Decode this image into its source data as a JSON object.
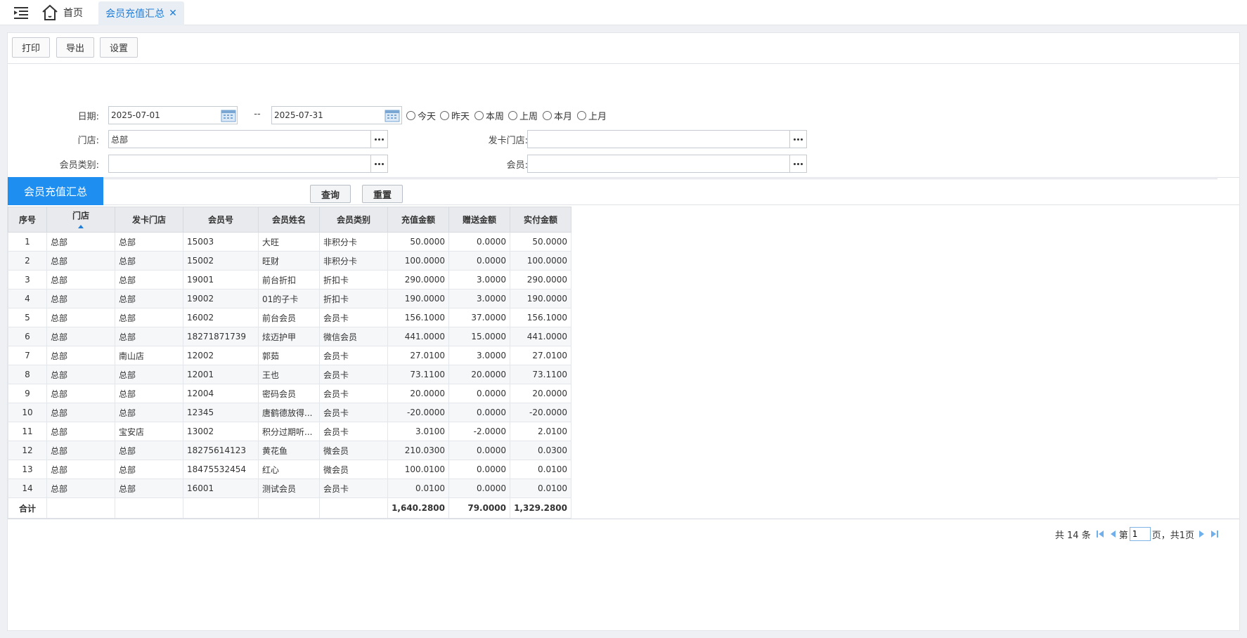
{
  "tabs": {
    "home_label": "首页",
    "active_label": "会员充值汇总",
    "close_glyph": "✕"
  },
  "toolbar": {
    "print_label": "打印",
    "export_label": "导出",
    "settings_label": "设置"
  },
  "filters": {
    "date_label": "日期:",
    "date_from": "2025-07-01",
    "date_sep": "--",
    "date_to": "2025-07-31",
    "quick_ranges": [
      "今天",
      "昨天",
      "本周",
      "上周",
      "本月",
      "上月"
    ],
    "store_label": "门店:",
    "store_value": "总部",
    "card_store_label": "发卡门店:",
    "card_store_value": "",
    "member_type_label": "会员类别:",
    "member_type_value": "",
    "member_label": "会员:",
    "member_value": "",
    "query_label": "查询",
    "reset_label": "重置"
  },
  "section": {
    "title": "会员充值汇总"
  },
  "table": {
    "columns": [
      "序号",
      "门店",
      "发卡门店",
      "会员号",
      "会员姓名",
      "会员类别",
      "充值金额",
      "赠送金额",
      "实付金额"
    ],
    "sorted_column": "门店",
    "rows": [
      [
        "1",
        "总部",
        "总部",
        "15003",
        "大旺",
        "非积分卡",
        "50.0000",
        "0.0000",
        "50.0000"
      ],
      [
        "2",
        "总部",
        "总部",
        "15002",
        "旺财",
        "非积分卡",
        "100.0000",
        "0.0000",
        "100.0000"
      ],
      [
        "3",
        "总部",
        "总部",
        "19001",
        "前台折扣",
        "折扣卡",
        "290.0000",
        "3.0000",
        "290.0000"
      ],
      [
        "4",
        "总部",
        "总部",
        "19002",
        "01的子卡",
        "折扣卡",
        "190.0000",
        "3.0000",
        "190.0000"
      ],
      [
        "5",
        "总部",
        "总部",
        "16002",
        "前台会员",
        "会员卡",
        "156.1000",
        "37.0000",
        "156.1000"
      ],
      [
        "6",
        "总部",
        "总部",
        "18271871739",
        "炫迈护甲",
        "微信会员",
        "441.0000",
        "15.0000",
        "441.0000"
      ],
      [
        "7",
        "总部",
        "南山店",
        "12002",
        "郭茹",
        "会员卡",
        "27.0100",
        "3.0000",
        "27.0100"
      ],
      [
        "8",
        "总部",
        "总部",
        "12001",
        "王也",
        "会员卡",
        "73.1100",
        "20.0000",
        "73.1100"
      ],
      [
        "9",
        "总部",
        "总部",
        "12004",
        "密码会员",
        "会员卡",
        "20.0000",
        "0.0000",
        "20.0000"
      ],
      [
        "10",
        "总部",
        "总部",
        "12345",
        "唐鹤德放得...",
        "会员卡",
        "-20.0000",
        "0.0000",
        "-20.0000"
      ],
      [
        "11",
        "总部",
        "宝安店",
        "13002",
        "积分过期听...",
        "会员卡",
        "3.0100",
        "-2.0000",
        "2.0100"
      ],
      [
        "12",
        "总部",
        "总部",
        "18275614123",
        "黄花鱼",
        "微会员",
        "210.0300",
        "0.0000",
        "0.0300"
      ],
      [
        "13",
        "总部",
        "总部",
        "18475532454",
        "红心",
        "微会员",
        "100.0100",
        "0.0000",
        "0.0100"
      ],
      [
        "14",
        "总部",
        "总部",
        "16001",
        "测试会员",
        "会员卡",
        "0.0100",
        "0.0000",
        "0.0100"
      ]
    ],
    "total_row": [
      "合计",
      "",
      "",
      "",
      "",
      "",
      "1,640.2800",
      "79.0000",
      "1,329.2800"
    ]
  },
  "pager": {
    "total_text": "共 14 条",
    "page_prefix": "第",
    "page_value": "1",
    "page_suffix": "页，共1页"
  },
  "colors": {
    "accent": "#1e8ef0",
    "tab_text": "#1e7ed8",
    "pager_icon": "#6fb0ec"
  },
  "icons": {
    "menu": "menu-collapse-icon",
    "home": "home-icon",
    "calendar": "calendar-icon",
    "more": "ellipsis-icon",
    "pager": [
      "first-page-icon",
      "prev-page-icon",
      "next-page-icon",
      "last-page-icon"
    ]
  }
}
